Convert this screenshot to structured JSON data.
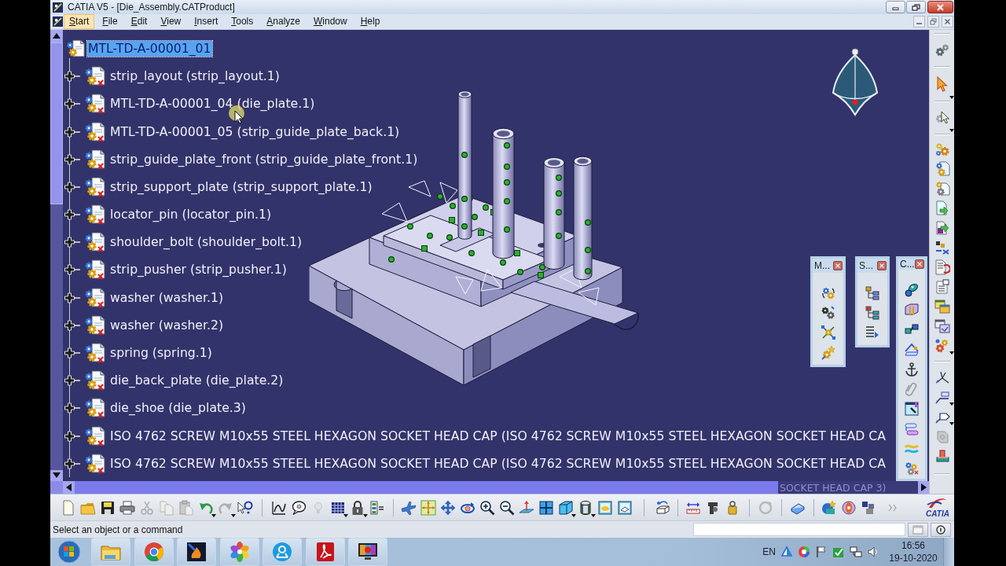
{
  "window": {
    "title": "CATIA V5 - [Die_Assembly.CATProduct]"
  },
  "menu": [
    {
      "label": "Start",
      "selected": true
    },
    {
      "label": "File",
      "selected": false
    },
    {
      "label": "Edit",
      "selected": false
    },
    {
      "label": "View",
      "selected": false
    },
    {
      "label": "Insert",
      "selected": false
    },
    {
      "label": "Tools",
      "selected": false
    },
    {
      "label": "Analyze",
      "selected": false
    },
    {
      "label": "Window",
      "selected": false
    },
    {
      "label": "Help",
      "selected": false
    }
  ],
  "tree": {
    "root": {
      "label": "MTL-TD-A-00001_01",
      "selected": true,
      "children": [
        {
          "label": "strip_layout (strip_layout.1)",
          "expanded": false,
          "selected": false
        },
        {
          "label": "MTL-TD-A-00001_04 (die_plate.1)",
          "expanded": false,
          "selected": false
        },
        {
          "label": "MTL-TD-A-00001_05 (strip_guide_plate_back.1)",
          "expanded": false,
          "selected": false
        },
        {
          "label": "strip_guide_plate_front (strip_guide_plate_front.1)",
          "expanded": false,
          "selected": false
        },
        {
          "label": "strip_support_plate (strip_support_plate.1)",
          "expanded": false,
          "selected": false
        },
        {
          "label": "locator_pin (locator_pin.1)",
          "expanded": false,
          "selected": false
        },
        {
          "label": "shoulder_bolt (shoulder_bolt.1)",
          "expanded": false,
          "selected": false
        },
        {
          "label": "strip_pusher (strip_pusher.1)",
          "expanded": false,
          "selected": false
        },
        {
          "label": "washer (washer.1)",
          "expanded": false,
          "selected": false
        },
        {
          "label": "washer (washer.2)",
          "expanded": false,
          "selected": false
        },
        {
          "label": "spring (spring.1)",
          "expanded": false,
          "selected": false
        },
        {
          "label": "die_back_plate (die_plate.2)",
          "expanded": false,
          "selected": false
        },
        {
          "label": "die_shoe (die_plate.3)",
          "expanded": false,
          "selected": false
        },
        {
          "label": "ISO 4762 SCREW M10x55 STEEL HEXAGON SOCKET HEAD CAP (ISO 4762 SCREW M10x55 STEEL HEXAGON SOCKET HEAD CA",
          "expanded": false,
          "selected": false
        },
        {
          "label": "ISO 4762 SCREW M10x55 STEEL HEXAGON SOCKET HEAD CAP (ISO 4762 SCREW M10x55 STEEL HEXAGON SOCKET HEAD CA",
          "expanded": false,
          "selected": false
        }
      ]
    },
    "partly_hidden_row": "SOCKET HEAD CAP 3)"
  },
  "floating_toolbars": [
    {
      "title": "M..."
    },
    {
      "title": "S..."
    },
    {
      "title": "C..."
    }
  ],
  "status_bar": {
    "message": "Select an object or a command"
  },
  "logo": {
    "text": "CATIA"
  },
  "taskbar": {
    "language": "EN",
    "time": "16:56",
    "date": "19-10-2020"
  }
}
